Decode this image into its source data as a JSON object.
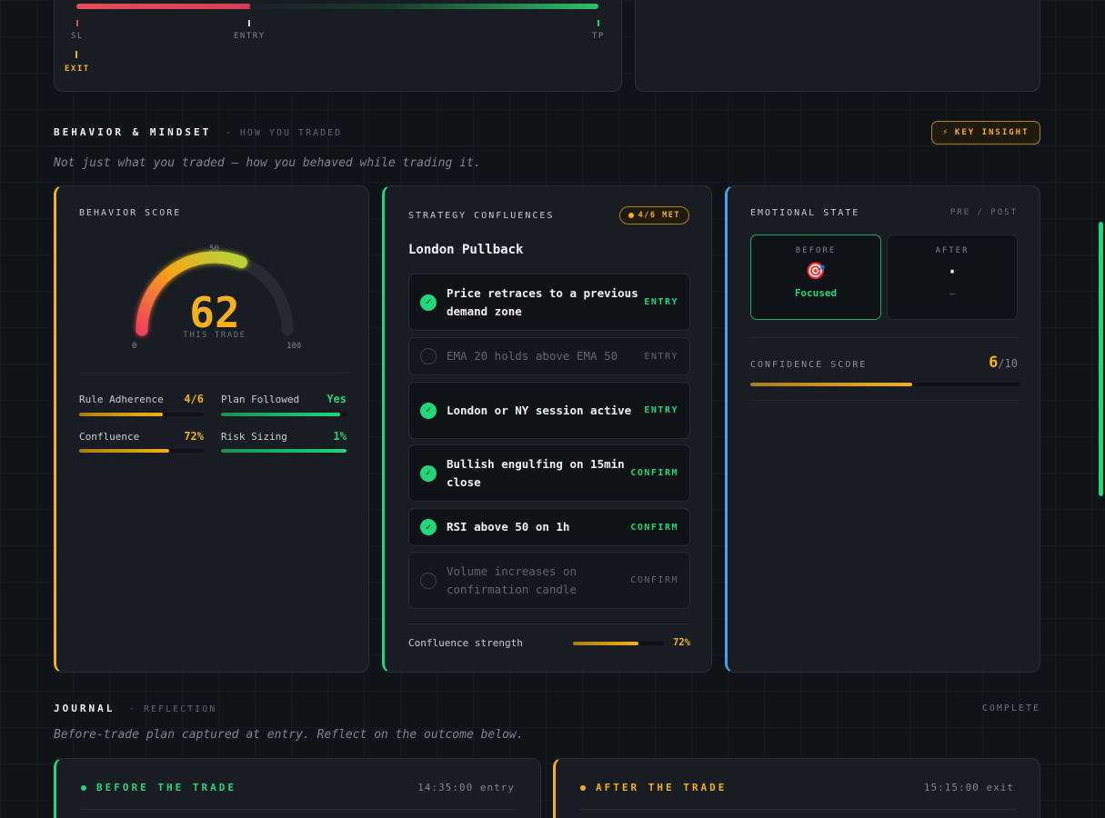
{
  "range": {
    "labels": {
      "sl": "SL",
      "entry": "ENTRY",
      "tp": "TP",
      "exit": "EXIT"
    },
    "colors": {
      "loss": "#e84a5f",
      "profit": "#2fbf6a",
      "exit": "#f5b01a"
    }
  },
  "behavior": {
    "title": "BEHAVIOR & MINDSET",
    "subtitle": "· HOW YOU TRADED",
    "insight_label": "KEY INSIGHT",
    "insight_icon": "lightning-icon",
    "note": "Not just what you traded — how you behaved while trading it."
  },
  "score": {
    "title": "BEHAVIOR SCORE",
    "value": "62",
    "value_num": 62,
    "caption": "THIS TRADE",
    "min": "0",
    "mid": "50",
    "max": "100",
    "stats": [
      {
        "label": "Rule Adherence",
        "value": "4/6",
        "fill": 0.67,
        "color": "#f5b01a"
      },
      {
        "label": "Plan Followed",
        "value": "Yes",
        "fill": 0.95,
        "color": "#22d67a"
      },
      {
        "label": "Confluence",
        "value": "72%",
        "fill": 0.72,
        "color": "#f5b01a"
      },
      {
        "label": "Risk Sizing",
        "value": "1%",
        "fill": 1.0,
        "color": "#22d67a"
      }
    ]
  },
  "confluences": {
    "title": "STRATEGY CONFLUENCES",
    "badge": "4/6 MET",
    "strategy": "London Pullback",
    "items": [
      {
        "text": "Price retraces to a previous demand zone",
        "tag": "ENTRY",
        "met": true
      },
      {
        "text": "EMA 20 holds above EMA 50",
        "tag": "ENTRY",
        "met": false
      },
      {
        "text": "London or NY session active",
        "tag": "ENTRY",
        "met": true
      },
      {
        "text": "Bullish engulfing on 15min close",
        "tag": "CONFIRM",
        "met": true
      },
      {
        "text": "RSI above 50 on 1h",
        "tag": "CONFIRM",
        "met": true
      },
      {
        "text": "Volume increases on confirmation candle",
        "tag": "CONFIRM",
        "met": false
      }
    ],
    "strength_label": "Confluence strength",
    "strength_value": "72%",
    "strength_fill": 0.72
  },
  "emotion": {
    "title": "EMOTIONAL STATE",
    "subtitle": "PRE / POST",
    "before_label": "BEFORE",
    "before_icon": "target-icon",
    "before_glyph": "🎯",
    "before_value": "Focused",
    "after_label": "AFTER",
    "after_glyph": "·",
    "after_value": "—",
    "confidence_label": "CONFIDENCE SCORE",
    "confidence_value": "6",
    "confidence_max": "/10",
    "confidence_fill": 0.6
  },
  "journal": {
    "title": "JOURNAL",
    "subtitle": "· REFLECTION",
    "status": "COMPLETE",
    "note": "Before-trade plan captured at entry. Reflect on the outcome below.",
    "before": {
      "title": "BEFORE THE TRADE",
      "time": "14:35:00 entry"
    },
    "after": {
      "title": "AFTER THE TRADE",
      "time": "15:15:00 exit"
    }
  }
}
